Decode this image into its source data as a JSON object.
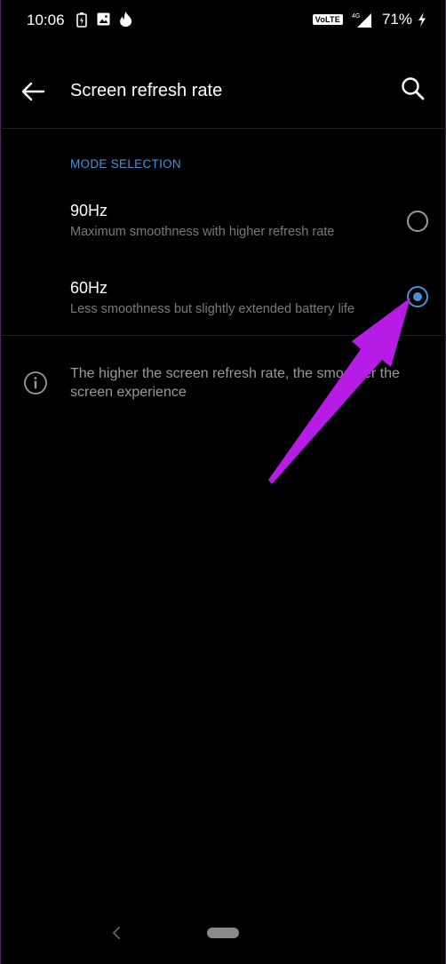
{
  "status_bar": {
    "time": "10:06",
    "network_badge": "VoLTE",
    "network_type": "4G",
    "battery_percent": "71%",
    "icons": [
      "battery-saver-icon",
      "image-icon",
      "tinder-flame-icon",
      "signal-icon",
      "charging-icon"
    ]
  },
  "app_bar": {
    "title": "Screen refresh rate"
  },
  "section": {
    "header": "MODE SELECTION"
  },
  "options": [
    {
      "title": "90Hz",
      "subtitle": "Maximum smoothness with higher refresh rate",
      "selected": false
    },
    {
      "title": "60Hz",
      "subtitle": "Less smoothness but slightly extended battery life",
      "selected": true
    }
  ],
  "info": {
    "text": "The higher the screen refresh rate, the smoother the screen experience"
  },
  "colors": {
    "accent": "#4f8fd8",
    "annotation": "#b71be6",
    "background": "#000000"
  }
}
